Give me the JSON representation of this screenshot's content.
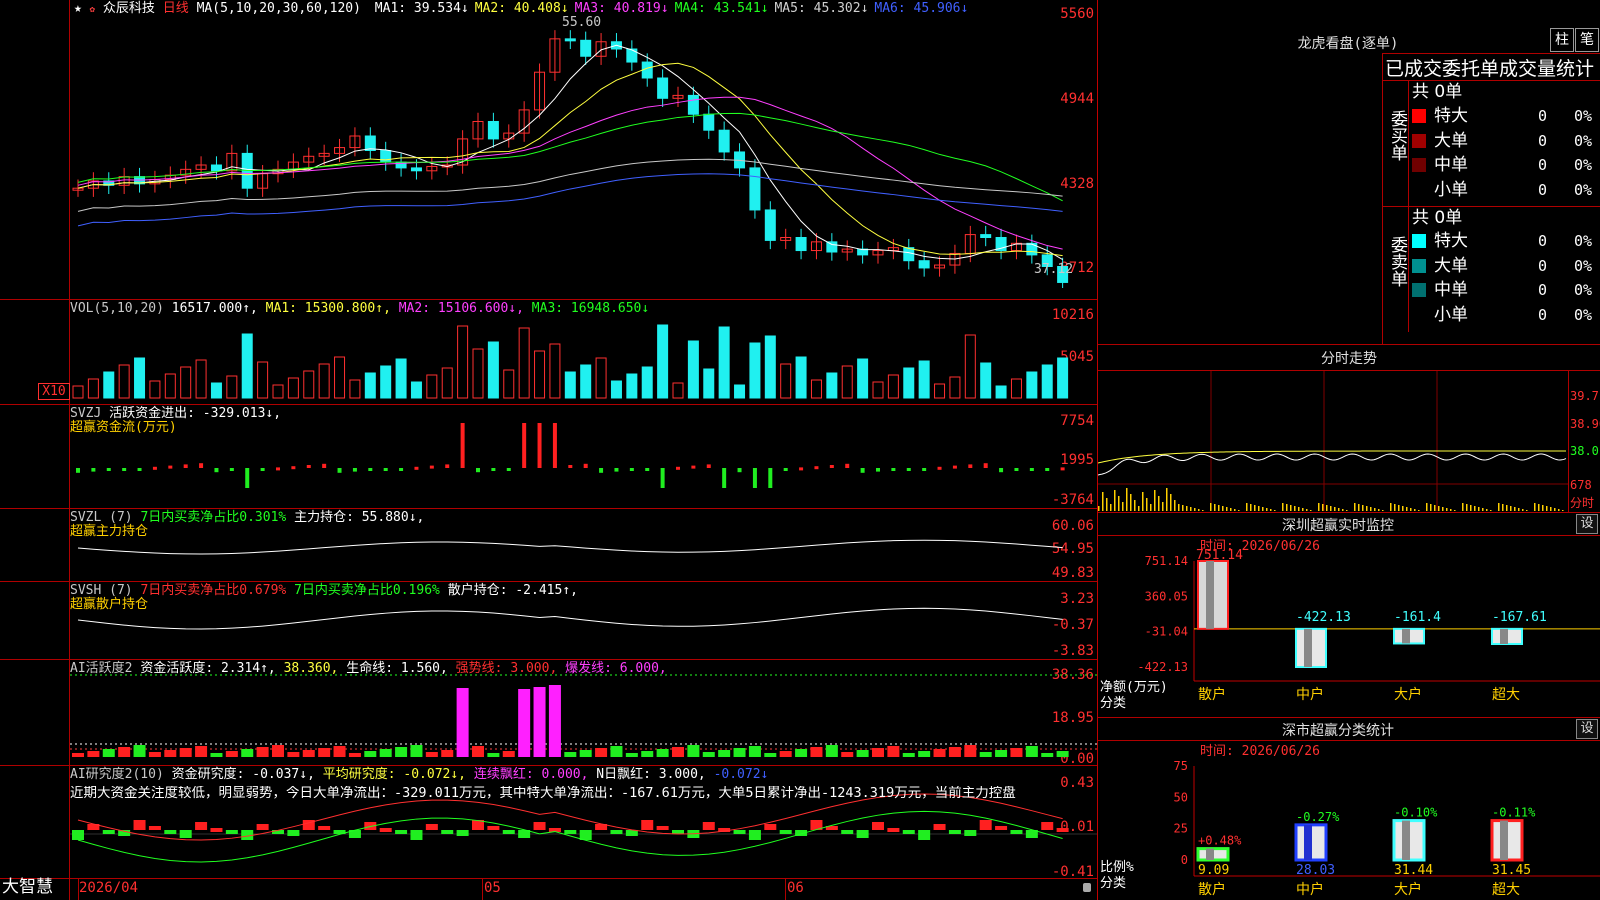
{
  "main": {
    "title_star": "★",
    "stock_name": "众辰科技",
    "period": "日线",
    "ma_label": "MA(5,10,20,30,60,120)",
    "ma": [
      {
        "text": "MA1: 39.534↓",
        "color": "#ffffff"
      },
      {
        "text": "MA2: 40.408↓",
        "color": "#ffff40"
      },
      {
        "text": "MA3: 40.819↓",
        "color": "#ff40ff"
      },
      {
        "text": "MA4: 43.541↓",
        "color": "#20ff20"
      },
      {
        "text": "MA5: 45.302↓",
        "color": "#d0d0d0"
      },
      {
        "text": "MA6: 45.906↓",
        "color": "#4060ff"
      }
    ],
    "y_axis": [
      "5560",
      "4944",
      "4328",
      "3712"
    ],
    "high_label": "55.60",
    "low_label": "37.12"
  },
  "vol": {
    "label": "VOL(5,10,20)",
    "value": "16517.000↑,",
    "ma1": "MA1: 15300.800↑,",
    "ma2": "MA2: 15106.600↓,",
    "ma3": "MA3: 16948.650↓",
    "y_axis": [
      "10216",
      "5045",
      "X10"
    ]
  },
  "svzj": {
    "label": "SVZJ",
    "text": "活跃资金进出: -329.013↓,",
    "sub": "超赢资金流(万元)",
    "y_axis": [
      "7754",
      "1995",
      "-3764"
    ]
  },
  "svzl": {
    "label": "SVZL (7)",
    "text1": "7日内买卖净占比0.301%",
    "text2": "主力持仓: 55.880↓,",
    "sub": "超赢主力持仓",
    "y_axis": [
      "60.06",
      "54.95",
      "49.83"
    ]
  },
  "svsh": {
    "label": "SVSH (7)",
    "text1": "7日内买卖净占比0.679%",
    "text2": "7日内买卖净占比0.196%",
    "text3": "散户持仓: -2.415↑,",
    "sub": "超赢散户持仓",
    "y_axis": [
      "3.23",
      "-0.37",
      "-3.83"
    ]
  },
  "ai1": {
    "label": "AI活跃度2",
    "t1": "资金活跃度: 2.314↑,",
    "t2": "38.360,",
    "t3": "生命线: 1.560,",
    "t4": "强势线: 3.000,",
    "t5": "爆发线: 6.000,",
    "y_axis": [
      "38.36",
      "18.95",
      "0.00"
    ]
  },
  "ai2": {
    "label": "AI研究度2(10)",
    "t1": "资金研究度: -0.037↓,",
    "t2": "平均研究度: -0.072↓,",
    "t3": "连续飘红: 0.000,",
    "t4": "N日飘红: 3.000,",
    "t5": "-0.072↓",
    "comment": "近期大资金关注度较低，明显弱势，今日大单净流出：-329.011万元，其中特大单净流出：-167.61万元，大单5日累计净出-1243.319万元，当前主力控盘",
    "y_axis": [
      "0.43",
      "0.01",
      "-0.41"
    ]
  },
  "bottom": {
    "brand": "大智慧",
    "dates": [
      "2026/04",
      "05",
      "06"
    ]
  },
  "lhb": {
    "title": "龙虎看盘(逐单)",
    "btn1": "柱",
    "btn2": "笔",
    "header": "已成交委托单成交量统计",
    "buy_label": "委买单",
    "sell_label": "委卖单",
    "buy_total": "共 0单",
    "sell_total": "共 0单",
    "buy_rows": [
      {
        "name": "特大",
        "count": "0",
        "pct": "0%",
        "color": "#ff0000"
      },
      {
        "name": "大单",
        "count": "0",
        "pct": "0%",
        "color": "#a00000"
      },
      {
        "name": "中单",
        "count": "0",
        "pct": "0%",
        "color": "#700000"
      },
      {
        "name": "小单",
        "count": "0",
        "pct": "0%",
        "color": "#000000"
      }
    ],
    "sell_rows": [
      {
        "name": "特大",
        "count": "0",
        "pct": "0%",
        "color": "#00ffff"
      },
      {
        "name": "大单",
        "count": "0",
        "pct": "0%",
        "color": "#009090"
      },
      {
        "name": "中单",
        "count": "0",
        "pct": "0%",
        "color": "#007070"
      },
      {
        "name": "小单",
        "count": "0",
        "pct": "0%",
        "color": "#000000"
      }
    ]
  },
  "fenshi": {
    "title": "分时走势",
    "y_axis": [
      "39.7",
      "38.90",
      "38.01",
      "678"
    ],
    "unit": "分时"
  },
  "szmonitor": {
    "title": "深圳超赢实时监控",
    "set": "设",
    "time": "时间: 2026/06/26",
    "y_axis": [
      "751.14",
      "360.05",
      "-31.04",
      "-422.13"
    ],
    "ylab1": "净额(万元)",
    "ylab2": "分类",
    "bars": [
      {
        "cat": "散户",
        "value": 751.14,
        "label": "751.14"
      },
      {
        "cat": "中户",
        "value": -422.13,
        "label": "-422.13"
      },
      {
        "cat": "大户",
        "value": -161.4,
        "label": "-161.4"
      },
      {
        "cat": "超大",
        "value": -167.61,
        "label": "-167.61"
      }
    ]
  },
  "szstat": {
    "title": "深市超赢分类统计",
    "set": "设",
    "time": "时间: 2026/06/26",
    "y_axis": [
      "75",
      "50",
      "25",
      "0"
    ],
    "ylab1": "比例%",
    "ylab2": "分类",
    "bars": [
      {
        "cat": "散户",
        "value": 9.09,
        "label": "9.09",
        "chg": "+0.48%"
      },
      {
        "cat": "中户",
        "value": 28.03,
        "label": "28.03",
        "chg": "-0.27%"
      },
      {
        "cat": "大户",
        "value": 31.44,
        "label": "31.44",
        "chg": "-0.10%"
      },
      {
        "cat": "超大",
        "value": 31.45,
        "label": "31.45",
        "chg": "-0.11%"
      }
    ]
  }
}
